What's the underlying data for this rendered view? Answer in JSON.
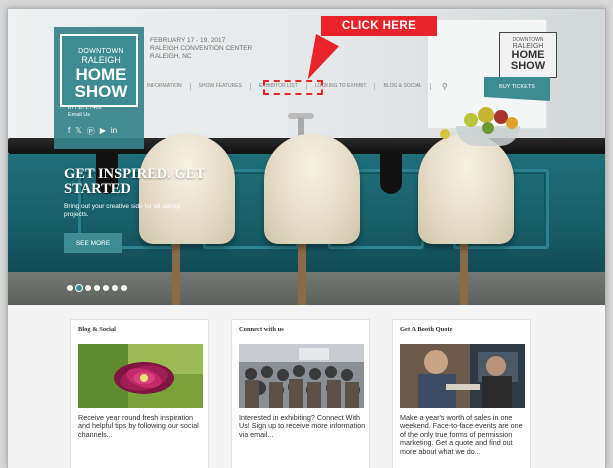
{
  "callout": {
    "label": "CLICK HERE"
  },
  "logo": {
    "line1": "DOWNTOWN",
    "line2": "RALEIGH",
    "line3": "HOME",
    "line4": "SHOW"
  },
  "contact": {
    "phone": "877.871.7469",
    "email": "Email Us"
  },
  "event": {
    "dates": "FEBRUARY 17 - 19, 2017",
    "venue": "RALEIGH CONVENTION CENTER",
    "city": "RALEIGH, NC"
  },
  "nav": {
    "items": [
      {
        "label": "INFORMATION"
      },
      {
        "label": "SHOW FEATURES"
      },
      {
        "label": "EXHIBITOR LIST"
      },
      {
        "label": "LOOKING TO EXHIBIT"
      },
      {
        "label": "BLOG & SOCIAL"
      }
    ],
    "buy_label": "BUY TICKETS"
  },
  "hero": {
    "title": "GET INSPIRED. GET STARTED",
    "text": "Bring out your creative side for all spring projects.",
    "button_label": "SEE MORE",
    "slide_count": 7,
    "active_slide": 1
  },
  "cards": [
    {
      "title": "Blog & Social",
      "text": "Receive year round fresh inspiration and helpful tips by following our social channels..."
    },
    {
      "title": "Connect with us",
      "text": "Interested in exhibiting? Connect With Us! Sign up to receive more information via email..."
    },
    {
      "title": "Get A Booth Quote",
      "text": "Make a year's worth of sales in one weekend. Face-to-face events are one of the only true forms of permission marketing. Get a quote and find out more about what we do..."
    }
  ],
  "colors": {
    "brand_teal": "#3e8c93",
    "callout_red": "#e8232a"
  },
  "icons": [
    "facebook-icon",
    "twitter-icon",
    "pinterest-icon",
    "youtube-icon",
    "linkedin-icon",
    "search-icon"
  ]
}
